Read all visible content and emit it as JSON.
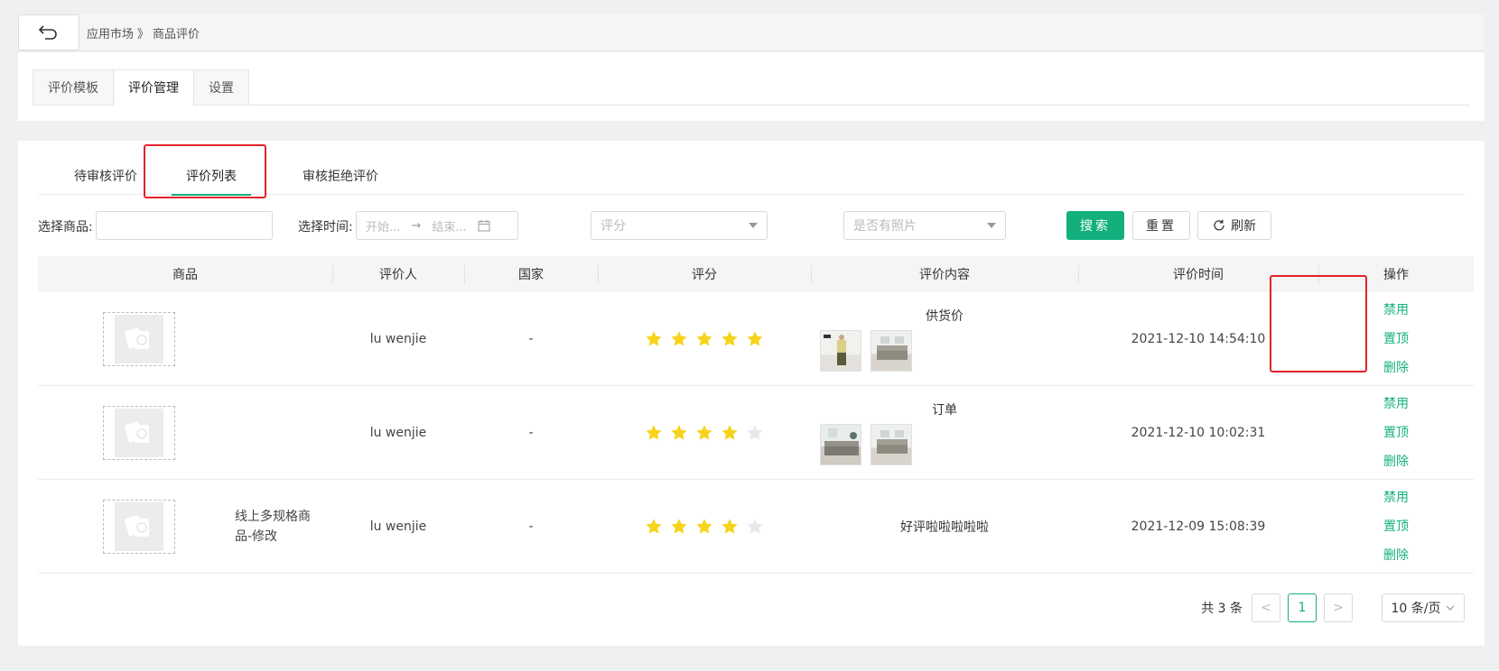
{
  "breadcrumb": {
    "root": "应用市场",
    "sep": "》",
    "current": "商品评价"
  },
  "top_tabs": [
    {
      "label": "评价模板",
      "active": false
    },
    {
      "label": "评价管理",
      "active": true
    },
    {
      "label": "设置",
      "active": false
    }
  ],
  "sub_tabs": [
    {
      "label": "待审核评价",
      "active": false
    },
    {
      "label": "评价列表",
      "active": true
    },
    {
      "label": "审核拒绝评价",
      "active": false
    }
  ],
  "filters": {
    "product_label": "选择商品:",
    "product_value": "",
    "time_label": "选择时间:",
    "start_placeholder": "开始...",
    "end_placeholder": "结束...",
    "score_placeholder": "评分",
    "photo_placeholder": "是否有照片",
    "search_label": "搜索",
    "reset_label": "重置",
    "refresh_label": "刷新"
  },
  "table": {
    "headers": [
      "商品",
      "评价人",
      "国家",
      "评分",
      "评价内容",
      "评价时间",
      "操作"
    ],
    "rows": [
      {
        "product_name": "",
        "reviewer": "lu wenjie",
        "country": "-",
        "rating": 5,
        "content": "供货价",
        "photos": [
          "photo-person",
          "photo-sofa"
        ],
        "time": "2021-12-10 14:54:10",
        "actions": [
          "禁用",
          "置顶",
          "删除"
        ]
      },
      {
        "product_name": "",
        "reviewer": "lu wenjie",
        "country": "-",
        "rating": 4,
        "content": "订单",
        "photos": [
          "photo-room",
          "photo-sofa"
        ],
        "time": "2021-12-10 10:02:31",
        "actions": [
          "禁用",
          "置顶",
          "删除"
        ]
      },
      {
        "product_name": "线上多规格商品-修改",
        "reviewer": "lu wenjie",
        "country": "-",
        "rating": 4,
        "content": "好评啦啦啦啦啦",
        "photos": [],
        "time": "2021-12-09 15:08:39",
        "actions": [
          "禁用",
          "置顶",
          "删除"
        ]
      }
    ]
  },
  "pagination": {
    "total_text": "共 3 条",
    "current_page": "1",
    "page_size": "10 条/页"
  },
  "colors": {
    "accent": "#13b07e",
    "star_on": "#f7d31a",
    "star_off": "#e8e8e8",
    "highlight": "#e3222b"
  }
}
